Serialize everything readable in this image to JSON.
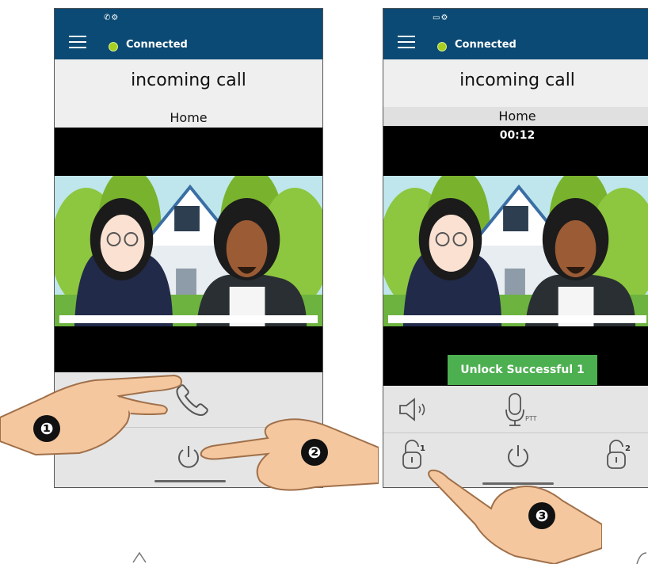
{
  "left_phone": {
    "status_icons": "✆⚙",
    "connection": "Connected",
    "title": "incoming call",
    "location": "Home"
  },
  "right_phone": {
    "status_icons": "▭⚙",
    "connection": "Connected",
    "title": "incoming call",
    "location": "Home",
    "timer": "00:12",
    "unlock_message": "Unlock Successful 1",
    "ptt_label": "PTT",
    "lock1_label": "1",
    "lock2_label": "2"
  },
  "steps": [
    "❶",
    "❷",
    "❸"
  ],
  "colors": {
    "status_bar": "#0b4a74",
    "connected_dot": "#a6cf1f",
    "unlock_banner": "#4caf50"
  },
  "icons": [
    "menu-icon",
    "handset-icon",
    "power-icon",
    "speaker-icon",
    "microphone-icon",
    "unlock-icon"
  ]
}
